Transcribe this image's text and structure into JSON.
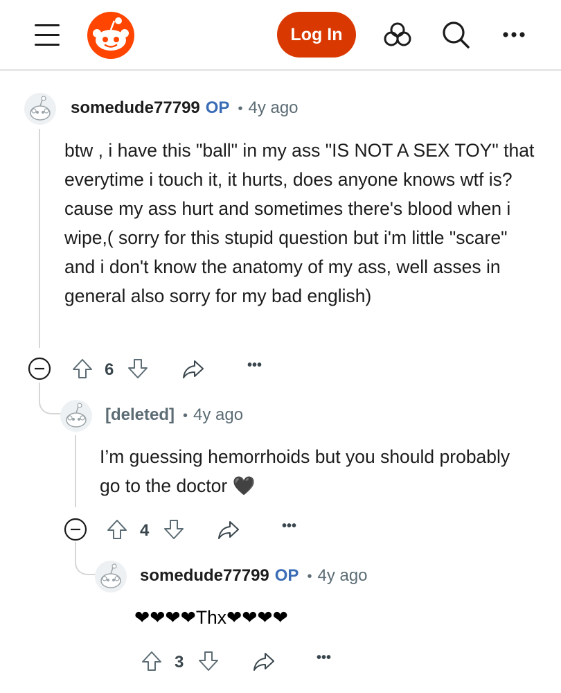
{
  "header": {
    "menu_icon": "hamburger-menu-icon",
    "logo": "reddit-logo",
    "login_label": "Log In",
    "icons": [
      "communities-icon",
      "search-icon",
      "more-icon"
    ],
    "brand_color": "#d93900"
  },
  "comments": [
    {
      "username": "somedude77799",
      "op": "OP",
      "dot": "•",
      "time": "4y ago",
      "text": "btw , i have this \"ball\" in my ass \"IS NOT A SEX TOY\" that everytime i touch it, it hurts, does anyone knows wtf is? cause my ass hurt and sometimes there's blood when i wipe,( sorry for this stupid question but i'm little \"scare\" and i don't know the anatomy of my ass, well asses in general also sorry for my bad english)",
      "votes": "6",
      "more": "•••"
    },
    {
      "username": "[deleted]",
      "dot": "•",
      "time": "4y ago",
      "text": "I’m guessing hemorrhoids but you should probably go to the doctor 🖤",
      "votes": "4",
      "more": "•••"
    },
    {
      "username": "somedude77799",
      "op": "OP",
      "dot": "•",
      "time": "4y ago",
      "text": "❤❤❤❤Thx❤❤❤❤",
      "votes": "3",
      "more": "•••"
    }
  ]
}
